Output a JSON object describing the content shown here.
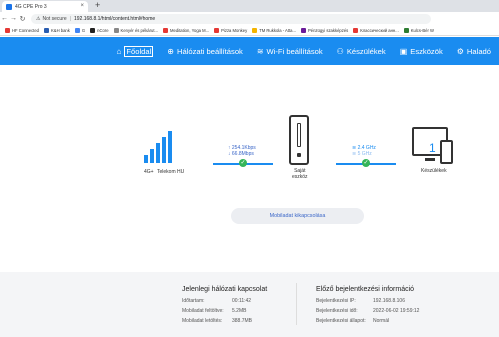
{
  "browser": {
    "tab_title": "4G CPE Pro 3",
    "tab_close": "×",
    "new_tab": "+",
    "security": "Not secure",
    "url": "192.168.8.1/html/content.html#home",
    "bookmarks": [
      "HF Connected",
      "K&H bank",
      "G",
      "nCore",
      "Kenyér és pékárut...",
      "Meditation, Yoga M...",
      "Pizza Monkey",
      "TM Rukkola - Atta...",
      "Pénzügyi szakképzés",
      "Классический анн...",
      "Kulcs-Bér W"
    ]
  },
  "nav": {
    "items": [
      {
        "icon": "⌂",
        "label": "Főoldal"
      },
      {
        "icon": "⊕",
        "label": "Hálózati beállítások"
      },
      {
        "icon": "≋",
        "label": "Wi-Fi beállítások"
      },
      {
        "icon": "⚇",
        "label": "Készülékek"
      },
      {
        "icon": "▣",
        "label": "Eszközök"
      },
      {
        "icon": "⚙",
        "label": "Haladó"
      }
    ]
  },
  "status": {
    "network_type": "4G+",
    "operator": "Telekom HU",
    "upload": "254.1Kbps",
    "download": "66.8Mbps",
    "router_label_1": "Saját",
    "router_label_2": "eszköz",
    "band_24": "2.4 GHz",
    "band_5": "5 GHz",
    "devices_count": "1",
    "devices_label": "Készülékek",
    "disconnect_button": "Mobiladat kikapcsolása"
  },
  "current_connection": {
    "title": "Jelenlegi hálózati kapcsolat",
    "rows": [
      {
        "label": "Időtartam:",
        "value": "00:11:42"
      },
      {
        "label": "Mobiladat feltöltve:",
        "value": "5.2MB"
      },
      {
        "label": "Mobiladat letöltés:",
        "value": "388.7MB"
      }
    ]
  },
  "previous_login": {
    "title": "Előző bejelentkezési információ",
    "rows": [
      {
        "label": "Bejelentkezési IP:",
        "value": "192.168.8.106"
      },
      {
        "label": "Bejelentkezési idő:",
        "value": "2022-06-02 19:59:12"
      },
      {
        "label": "Bejelentkezési állapot:",
        "value": "Normál"
      }
    ]
  }
}
